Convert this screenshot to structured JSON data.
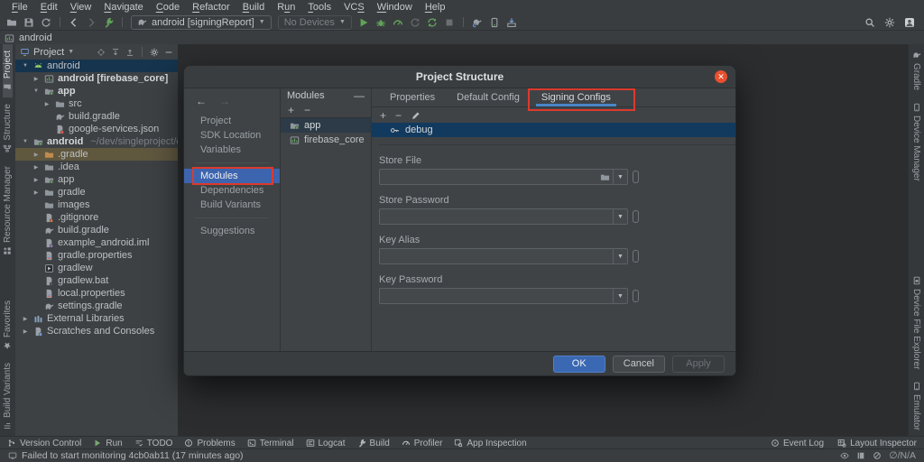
{
  "colors": {
    "accent_blue": "#3d64ae",
    "tab_underline": "#4a86c8",
    "annotation_red": "#dd3a2d",
    "ok_button_blue": "#3a68b2",
    "close_button_orange": "#e8502e",
    "selection_navy": "#123a5e",
    "tree_selection_blue": "#16344e",
    "excluded_tan": "#60573f",
    "icon_green": "#5fa357"
  },
  "menu": {
    "items": [
      {
        "label": "File",
        "m": 0
      },
      {
        "label": "Edit",
        "m": 0
      },
      {
        "label": "View",
        "m": 0
      },
      {
        "label": "Navigate",
        "m": 0
      },
      {
        "label": "Code",
        "m": 0
      },
      {
        "label": "Refactor",
        "m": 0
      },
      {
        "label": "Build",
        "m": 0
      },
      {
        "label": "Run",
        "m": 1
      },
      {
        "label": "Tools",
        "m": 0
      },
      {
        "label": "VCS",
        "m": 2
      },
      {
        "label": "Window",
        "m": 0
      },
      {
        "label": "Help",
        "m": 0
      }
    ]
  },
  "toolbar": {
    "group1": [
      "open",
      "save",
      "refresh"
    ],
    "group2": [
      "back",
      "forward",
      "hammer"
    ],
    "run_config_label": "android [signingReport]",
    "devices_label": "No Devices",
    "group3": [
      "run",
      "bug",
      "profileGauge",
      "coverage",
      "applyChanges",
      "stop"
    ],
    "group4": [
      "gradleSync",
      "deviceManager",
      "sdkManager"
    ],
    "right": [
      "search",
      "settings",
      "avatar"
    ]
  },
  "breadcrumb": {
    "label": "android"
  },
  "left_strip": {
    "top": [
      {
        "label": "Project",
        "icon": "stripProject",
        "active": true
      },
      {
        "label": "Structure",
        "icon": "stripStructure"
      },
      {
        "label": "Resource Manager",
        "icon": "stripResource"
      }
    ],
    "bottom": [
      {
        "label": "Favorites",
        "icon": "star"
      },
      {
        "label": "Build Variants",
        "icon": "stripVariants"
      }
    ]
  },
  "right_strip": {
    "top": [
      {
        "label": "Gradle",
        "icon": "gradle"
      },
      {
        "label": "Device Manager",
        "icon": "deviceManager"
      }
    ],
    "bottom": [
      {
        "label": "Device File Explorer",
        "icon": "deviceExplorer"
      },
      {
        "label": "Emulator",
        "icon": "emulator"
      }
    ]
  },
  "project_panel": {
    "title": "Project",
    "header_icons": [
      "locate",
      "expandAll",
      "collapseAll",
      "divider",
      "settings",
      "minusWide"
    ],
    "tree": [
      {
        "arrow": "v",
        "icon": "androidHead",
        "label": "android",
        "sel": "blue",
        "ind": 6
      },
      {
        "arrow": ">",
        "icon": "module",
        "label": "android [firebase_core]",
        "bold": true,
        "ind": 18
      },
      {
        "arrow": "v",
        "icon": "folderAndroid",
        "label": "app",
        "bold": true,
        "ind": 18
      },
      {
        "arrow": ">",
        "icon": "folder",
        "label": "src",
        "ind": 30
      },
      {
        "arrow": "",
        "icon": "gradle",
        "label": "build.gradle",
        "ind": 30
      },
      {
        "arrow": "",
        "icon": "json",
        "label": "google-services.json",
        "ind": 30
      },
      {
        "arrow": "v",
        "icon": "folderAndroid",
        "label": "android",
        "suffix": "~/dev/singleproject/examp",
        "bold": true,
        "ind": 6
      },
      {
        "arrow": ">",
        "icon": "folderExcluded",
        "label": ".gradle",
        "sel": "tan",
        "ind": 18
      },
      {
        "arrow": ">",
        "icon": "folder",
        "label": ".idea",
        "ind": 18
      },
      {
        "arrow": ">",
        "icon": "folderAndroid",
        "label": "app",
        "ind": 18
      },
      {
        "arrow": ">",
        "icon": "folder",
        "label": "gradle",
        "ind": 18
      },
      {
        "arrow": "",
        "icon": "folder",
        "label": "images",
        "ind": 18
      },
      {
        "arrow": "",
        "icon": "git",
        "label": ".gitignore",
        "ind": 18
      },
      {
        "arrow": "",
        "icon": "gradle",
        "label": "build.gradle",
        "ind": 18
      },
      {
        "arrow": "",
        "icon": "iml",
        "label": "example_android.iml",
        "ind": 18
      },
      {
        "arrow": "",
        "icon": "properties",
        "label": "gradle.properties",
        "ind": 18
      },
      {
        "arrow": "",
        "icon": "gradlew",
        "label": "gradlew",
        "ind": 18
      },
      {
        "arrow": "",
        "icon": "bat",
        "label": "gradlew.bat",
        "ind": 18
      },
      {
        "arrow": "",
        "icon": "properties",
        "label": "local.properties",
        "ind": 18
      },
      {
        "arrow": "",
        "icon": "gradle",
        "label": "settings.gradle",
        "ind": 18
      },
      {
        "arrow": ">",
        "icon": "library",
        "label": "External Libraries",
        "ind": 6
      },
      {
        "arrow": ">",
        "icon": "scratch",
        "label": "Scratches and Consoles",
        "ind": 6
      }
    ]
  },
  "dialog": {
    "title": "Project Structure",
    "nav": {
      "groups": [
        [
          {
            "label": "Project"
          },
          {
            "label": "SDK Location"
          },
          {
            "label": "Variables"
          }
        ],
        [
          {
            "label": "Modules",
            "selected": true,
            "annotated": true
          },
          {
            "label": "Dependencies"
          },
          {
            "label": "Build Variants"
          }
        ],
        [
          {
            "label": "Suggestions"
          }
        ]
      ]
    },
    "modules_panel": {
      "title": "Modules",
      "toolbar": [
        "plus",
        "minus"
      ],
      "items": [
        {
          "label": "app",
          "icon": "folderAndroid",
          "selected": true
        },
        {
          "label": "firebase_core",
          "icon": "module"
        }
      ]
    },
    "tabs": [
      {
        "label": "Properties"
      },
      {
        "label": "Default Config"
      },
      {
        "label": "Signing Configs",
        "active": true,
        "annotated": true
      }
    ],
    "signing_toolbar": [
      "plus",
      "minus",
      "pencil"
    ],
    "configs": [
      {
        "label": "debug",
        "icon": "key",
        "selected": true
      }
    ],
    "fields": [
      {
        "label": "Store File",
        "folder": true
      },
      {
        "label": "Store Password"
      },
      {
        "label": "Key Alias"
      },
      {
        "label": "Key Password"
      }
    ],
    "buttons": [
      {
        "label": "OK",
        "kind": "primary"
      },
      {
        "label": "Cancel",
        "kind": "normal"
      },
      {
        "label": "Apply",
        "kind": "disabled"
      }
    ]
  },
  "dock": {
    "left": [
      {
        "label": "Version Control",
        "icon": "branch"
      },
      {
        "label": "Run",
        "icon": "playSmall"
      },
      {
        "label": "TODO",
        "icon": "todo"
      },
      {
        "label": "Problems",
        "icon": "problem"
      },
      {
        "label": "Terminal",
        "icon": "terminal"
      },
      {
        "label": "Logcat",
        "icon": "logcat"
      },
      {
        "label": "Build",
        "icon": "hammerGray"
      },
      {
        "label": "Profiler",
        "icon": "gauge"
      },
      {
        "label": "App Inspection",
        "icon": "inspect"
      }
    ],
    "right": [
      {
        "label": "Event Log",
        "icon": "event"
      },
      {
        "label": "Layout Inspector",
        "icon": "layout"
      }
    ]
  },
  "status": {
    "message": "Failed to start monitoring 4cb0ab11 (17 minutes ago)",
    "left_icon": "monitorSmall",
    "right_icons": [
      "eye",
      "book",
      "noentry"
    ],
    "right_text": "∅/N/A"
  }
}
